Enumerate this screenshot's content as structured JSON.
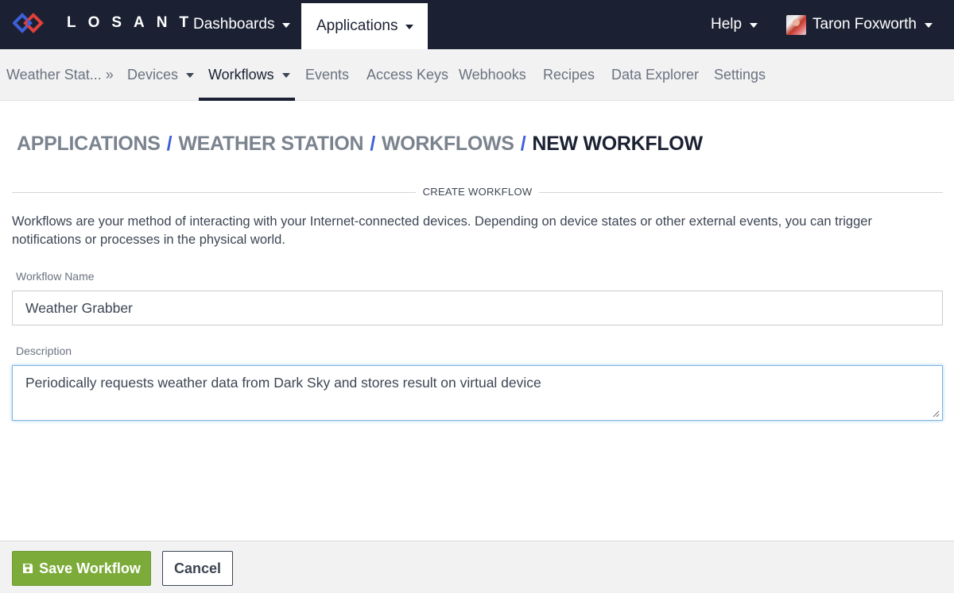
{
  "brand": {
    "name": "LOSANT"
  },
  "topnav": {
    "dashboards": "Dashboards",
    "applications": "Applications",
    "help": "Help",
    "user": "Taron Foxworth"
  },
  "subnav": {
    "app": "Weather Stat... »",
    "devices": "Devices",
    "workflows": "Workflows",
    "events": "Events",
    "access_keys": "Access Keys",
    "webhooks": "Webhooks",
    "recipes": "Recipes",
    "data_explorer": "Data Explorer",
    "settings": "Settings"
  },
  "breadcrumb": {
    "items": [
      "APPLICATIONS",
      "WEATHER STATION",
      "WORKFLOWS"
    ],
    "current": "NEW WORKFLOW",
    "separator": "/"
  },
  "section": {
    "title": "CREATE WORKFLOW"
  },
  "intro": "Workflows are your method of interacting with your Internet-connected devices. Depending on device states or other external events, you can trigger notifications or processes in the physical world.",
  "form": {
    "name_label": "Workflow Name",
    "name_value": "Weather Grabber",
    "description_label": "Description",
    "description_value": "Periodically requests weather data from Dark Sky and stores result on virtual device"
  },
  "footer": {
    "save_label": "Save Workflow",
    "cancel_label": "Cancel"
  },
  "colors": {
    "topbar": "#1b2133",
    "accent_blue": "#3e5fd8",
    "save_green": "#7cab3a",
    "logo_red": "#e0403a",
    "logo_blue": "#3e5fd8"
  },
  "icons": {
    "logo": "losant-logo-icon",
    "save": "floppy-disk-icon",
    "caret": "caret-down-icon",
    "resize": "resize-grip-icon"
  }
}
